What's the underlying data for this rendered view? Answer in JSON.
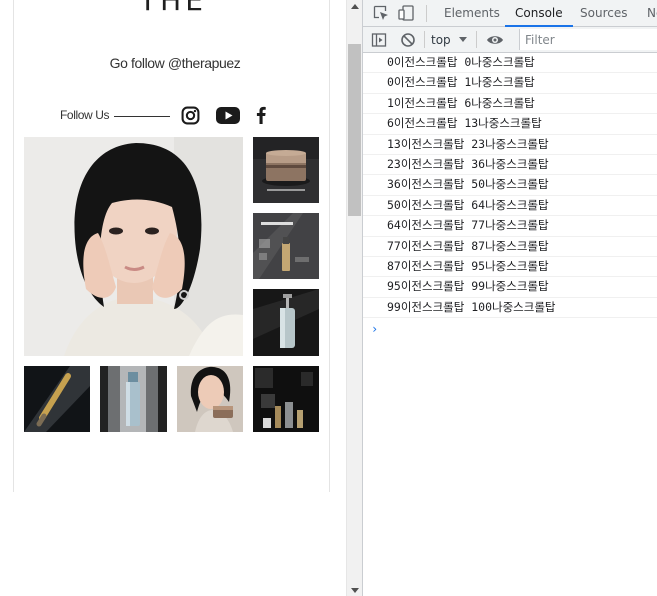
{
  "page": {
    "brand": "THE RAPUEZ",
    "follow_handle": "Go follow @therapuez",
    "follow_label": "Follow Us",
    "sns": [
      "instagram-icon",
      "youtube-icon",
      "facebook-icon"
    ]
  },
  "devtools": {
    "tabs": [
      "Elements",
      "Console",
      "Sources",
      "Ne"
    ],
    "active_tab": "Console",
    "context": "top",
    "filter_placeholder": "Filter",
    "console_lines": [
      "0이전스크롤탑 0나중스크롤탑",
      "0이전스크롤탑 1나중스크롤탑",
      "1이전스크롤탑 6나중스크롤탑",
      "6이전스크롤탑 13나중스크롤탑",
      "13이전스크롤탑 23나중스크롤탑",
      "23이전스크롤탑 36나중스크롤탑",
      "36이전스크롤탑 50나중스크롤탑",
      "50이전스크롤탑 64나중스크롤탑",
      "64이전스크롤탑 77나중스크롤탑",
      "77이전스크롤탑 87나중스크롤탑",
      "87이전스크롤탑 95나중스크롤탑",
      "95이전스크롤탑 99나중스크롤탑",
      "99이전스크롤탑 100나중스크롤탑"
    ],
    "prompt_symbol": "›"
  },
  "colors": {
    "accent": "#1a73e8",
    "devtools_bg": "#f1f3f4"
  }
}
